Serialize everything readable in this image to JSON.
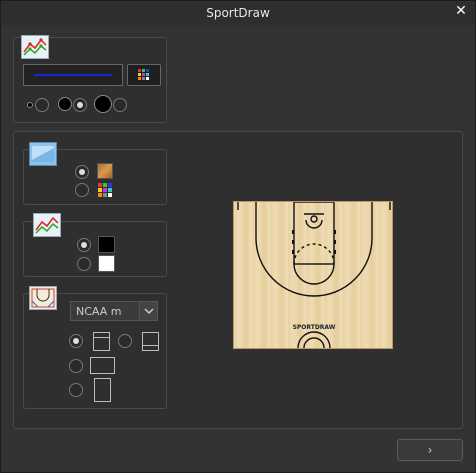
{
  "window": {
    "title": "SportDraw",
    "close_glyph": "✕"
  },
  "sport": {
    "selected": "NCAA m",
    "options": [
      "NCAA m"
    ]
  },
  "footer": {
    "next_label": "›"
  },
  "court": {
    "logo_text": "SPORTDRAW"
  }
}
